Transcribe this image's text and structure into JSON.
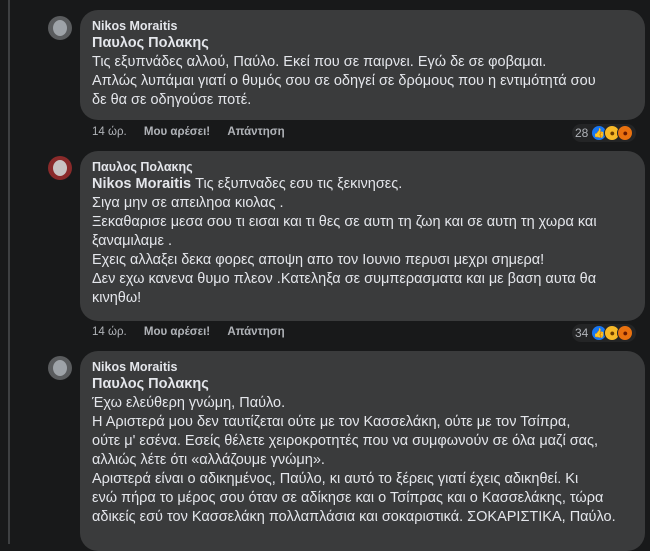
{
  "comments": [
    {
      "author": "Nikos Moraitis",
      "tag": "Παυλος Πολακης",
      "lines": [
        "Τις εξυπνάδες αλλού, Παύλο. Εκεί που σε παιρνει. Εγώ δε σε φοβαμαι.",
        "Απλώς λυπάμαι γιατί ο θυμός σου σε οδηγεί σε δρόμους που η εντιμότητά σου",
        "δε θα σε οδηγούσε ποτέ."
      ],
      "time": "14 ώρ.",
      "like": "Μου αρέσει!",
      "reply": "Απάντηση",
      "reaction_count": "28"
    },
    {
      "author": "Παυλος Πολακης",
      "tag": "Nikos Moraitis",
      "first_text": " Τις εξυπναδες εσυ τις ξεκινησες.",
      "lines": [
        "Σιγα μην σε απειληοα κιολας .",
        "Ξεκαθαρισε μεσα σου τι εισαι και τι θες σε αυτη τη ζωη και σε αυτη τη χωρα και",
        "ξαναμιλαμε .",
        "Εχεις αλλαξει δεκα φορες αποψη απο τον Ιουνιο περυσι μεχρι σημερα!",
        "Δεν εχω κανενα θυμο πλεον .Κατεληξα σε συμπερασματα και με βαση αυτα θα",
        "κινηθω!"
      ],
      "time": "14 ώρ.",
      "like": "Μου αρέσει!",
      "reply": "Απάντηση",
      "reaction_count": "34"
    },
    {
      "author": "Nikos Moraitis",
      "tag": "Παυλος Πολακης",
      "lines": [
        "Έχω ελεύθερη γνώμη, Παύλο.",
        "Η Αριστερά μου δεν ταυτίζεται ούτε με τον Κασσελάκη, ούτε με τον Τσίπρα,",
        "ούτε μ' εσένα. Εσείς θέλετε χειροκροτητές που να συμφωνούν σε όλα μαζί σας,",
        "αλλιώς λέτε ότι «αλλάζουμε γνώμη».",
        "Αριστερά είναι ο αδικημένος, Παύλο, κι αυτό το ξέρεις γιατί έχεις αδικηθεί. Κι",
        "ενώ πήρα το μέρος σου όταν σε αδίκησε και ο Τσίπρας και ο Κασσελάκης, τώρα",
        "αδικείς εσύ τον Κασσελάκη πολλαπλάσια και σοκαριστικά. ΣΟΚΑΡΙΣΤΙΚΑ, Παύλο."
      ]
    }
  ],
  "icons": {
    "like": "like-icon",
    "laugh": "laugh-icon",
    "angry": "angry-icon"
  },
  "colors": {
    "background": "#18191a",
    "bubble": "#3a3b3c",
    "text": "#e4e6eb",
    "meta": "#b0b3b8",
    "like": "#1877f2"
  }
}
